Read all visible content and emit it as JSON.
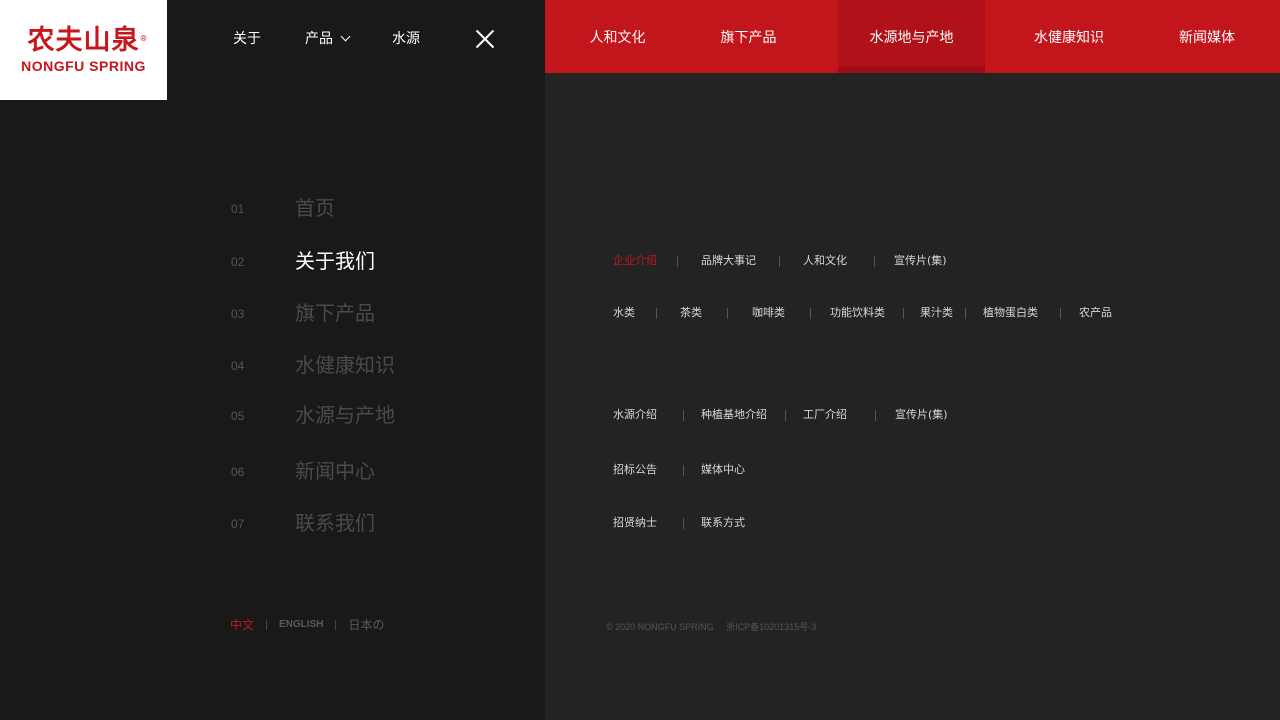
{
  "logo": {
    "cn": "农夫山泉",
    "reg": "®",
    "en": "NONGFU SPRING"
  },
  "top_nav": {
    "about": "关于",
    "products": "产品",
    "water_source": "水源"
  },
  "red_nav": [
    {
      "label": "人和文化"
    },
    {
      "label": "旗下产品"
    },
    {
      "label": "水源地与产地"
    },
    {
      "label": "水健康知识"
    },
    {
      "label": "新闻媒体"
    }
  ],
  "menu": [
    {
      "num": "01",
      "label": "首页"
    },
    {
      "num": "02",
      "label": "关于我们"
    },
    {
      "num": "03",
      "label": "旗下产品"
    },
    {
      "num": "04",
      "label": "水健康知识"
    },
    {
      "num": "05",
      "label": "水源与产地"
    },
    {
      "num": "06",
      "label": "新闻中心"
    },
    {
      "num": "07",
      "label": "联系我们"
    }
  ],
  "submenus": {
    "about": [
      "企业介绍",
      "品牌大事记",
      "人和文化",
      "宣传片(集)"
    ],
    "products": [
      "水类",
      "茶类",
      "咖啡类",
      "功能饮料类",
      "果汁类",
      "植物蛋白类",
      "农产品"
    ],
    "source": [
      "水源介绍",
      "种植基地介绍",
      "工厂介绍",
      "宣传片(集)"
    ],
    "news": [
      "招标公告",
      "媒体中心"
    ],
    "contact": [
      "招贤纳士",
      "联系方式"
    ]
  },
  "languages": [
    "中文",
    "ENGLISH",
    "日本の"
  ],
  "footer": {
    "copyright": "© 2020 NONGFU SPRING.    浙ICP备10201315号-3"
  },
  "colors": {
    "accent": "#c3161c",
    "left_bg": "#191919",
    "right_bg": "#232323"
  },
  "icons": {
    "close": "close-icon",
    "dropdown": "chevron-down-icon"
  }
}
